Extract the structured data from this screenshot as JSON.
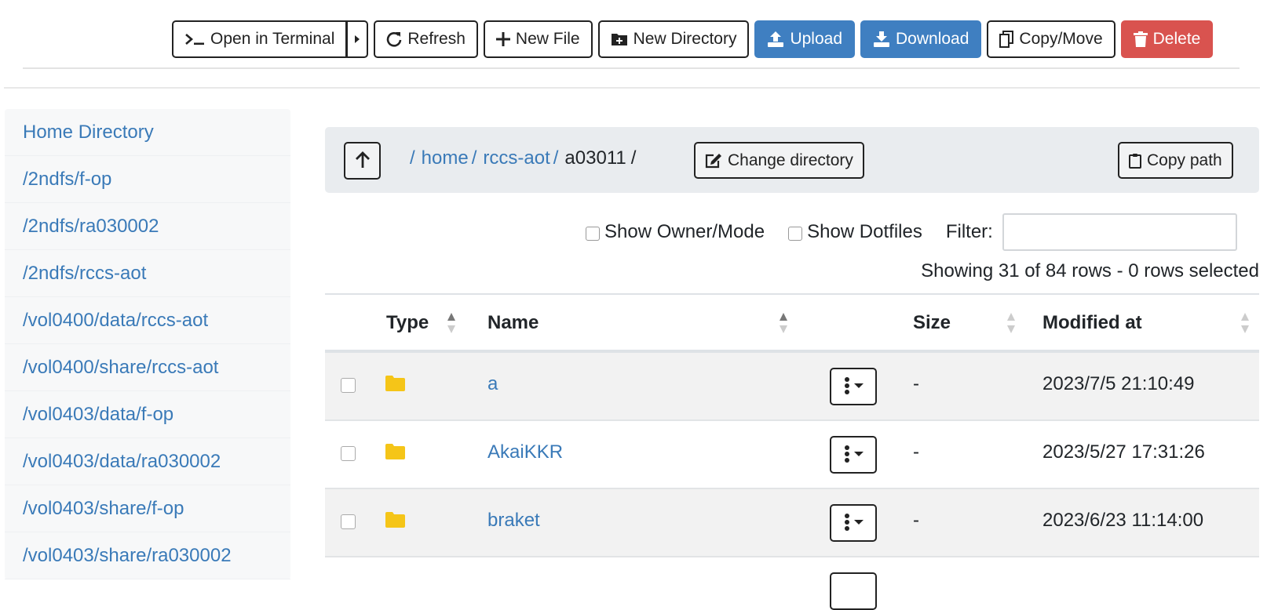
{
  "toolbar": {
    "open_terminal": "Open in Terminal",
    "refresh": "Refresh",
    "new_file": "New File",
    "new_directory": "New Directory",
    "upload": "Upload",
    "download": "Download",
    "copy_move": "Copy/Move",
    "delete": "Delete"
  },
  "colors": {
    "primary": "#3f7fc1",
    "danger": "#d9534f",
    "link": "#3a7ab8",
    "folder": "#f5c518"
  },
  "sidebar": {
    "items": [
      {
        "label": "Home Directory"
      },
      {
        "label": "/2ndfs/f-op"
      },
      {
        "label": "/2ndfs/ra030002"
      },
      {
        "label": "/2ndfs/rccs-aot"
      },
      {
        "label": "/vol0400/data/rccs-aot"
      },
      {
        "label": "/vol0400/share/rccs-aot"
      },
      {
        "label": "/vol0403/data/f-op"
      },
      {
        "label": "/vol0403/data/ra030002"
      },
      {
        "label": "/vol0403/share/f-op"
      },
      {
        "label": "/vol0403/share/ra030002"
      }
    ]
  },
  "breadcrumb": {
    "root_sep": "/",
    "parts": [
      {
        "label": "home",
        "sep": "/"
      },
      {
        "label": "rccs-aot",
        "sep": "/"
      }
    ],
    "current": "a03011",
    "current_sep": "/",
    "change_directory": "Change directory",
    "copy_path": "Copy path"
  },
  "options": {
    "show_owner_mode": "Show Owner/Mode",
    "show_dotfiles": "Show Dotfiles",
    "filter_label": "Filter:",
    "filter_value": ""
  },
  "rows_info": "Showing 31 of 84 rows - 0 rows selected",
  "table": {
    "headers": {
      "type": "Type",
      "name": "Name",
      "size": "Size",
      "modified": "Modified at"
    },
    "rows": [
      {
        "type_icon": "folder-icon",
        "name": "a",
        "size": "-",
        "modified": "2023/7/5 21:10:49"
      },
      {
        "type_icon": "folder-icon",
        "name": "AkaiKKR",
        "size": "-",
        "modified": "2023/5/27 17:31:26"
      },
      {
        "type_icon": "folder-icon",
        "name": "braket",
        "size": "-",
        "modified": "2023/6/23 11:14:00"
      }
    ]
  }
}
